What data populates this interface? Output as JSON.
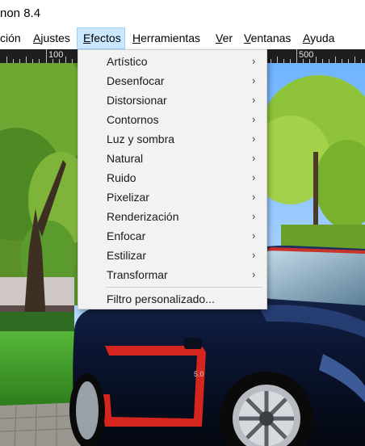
{
  "window": {
    "title": "non 8.4"
  },
  "menubar": {
    "items": [
      {
        "id": "edicion",
        "label": "ción"
      },
      {
        "id": "ajustes",
        "label": "Ajustes",
        "ul": "A",
        "rest": "justes"
      },
      {
        "id": "efectos",
        "label": "Efectos",
        "ul": "E",
        "rest": "fectos",
        "active": true
      },
      {
        "id": "herramientas",
        "label": "Herramientas",
        "ul": "H",
        "rest": "erramientas"
      },
      {
        "id": "ver",
        "label": "Ver",
        "ul": "V",
        "rest": "er"
      },
      {
        "id": "ventanas",
        "label": "Ventanas",
        "ul": "V",
        "rest": "entanas"
      },
      {
        "id": "ayuda",
        "label": "Ayuda",
        "ul": "A",
        "rest": "yuda"
      }
    ]
  },
  "ruler": {
    "labels": [
      "100",
      "500"
    ]
  },
  "effects_menu": {
    "items": [
      {
        "label": "Artístico",
        "submenu": true
      },
      {
        "label": "Desenfocar",
        "submenu": true
      },
      {
        "label": "Distorsionar",
        "submenu": true
      },
      {
        "label": "Contornos",
        "submenu": true
      },
      {
        "label": "Luz y sombra",
        "submenu": true
      },
      {
        "label": "Natural",
        "submenu": true
      },
      {
        "label": "Ruido",
        "submenu": true
      },
      {
        "label": "Pixelizar",
        "submenu": true
      },
      {
        "label": "Renderización",
        "submenu": true
      },
      {
        "label": "Enfocar",
        "submenu": true
      },
      {
        "label": "Estilizar",
        "submenu": true
      },
      {
        "label": "Transformar",
        "submenu": true
      }
    ],
    "custom_filter": "Filtro personalizado...",
    "submenu_glyph": "›"
  },
  "colors": {
    "menu_highlight": "#cce8ff",
    "ruler_bg": "#1e1e1e",
    "car_body": "#0d1a3a",
    "car_stripe": "#d4261f",
    "sky": "#8ec3ff",
    "grass": "#3f9a28"
  }
}
